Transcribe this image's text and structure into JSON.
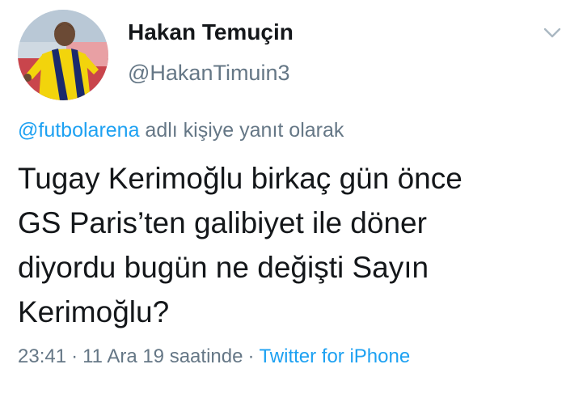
{
  "author": {
    "display_name": "Hakan Temuçin",
    "handle": "@HakanTimuin3"
  },
  "reply": {
    "mention": "@futbolarena",
    "suffix": " adlı kişiye yanıt olarak"
  },
  "tweet": {
    "lines": [
      "Tugay Kerimoğlu birkaç gün önce",
      "GS Paris’ten galibiyet ile döner",
      "diyordu bugün ne değişti Sayın",
      "Kerimoğlu?"
    ]
  },
  "meta": {
    "time": "23:41",
    "date_text": "11 Ara 19 saatinde",
    "separator": "·",
    "source": "Twitter for iPhone"
  },
  "icons": {
    "more": "chevron-down-icon",
    "avatar": "profile-photo"
  },
  "colors": {
    "link": "#1da1f2",
    "secondary_text": "#657786",
    "primary_text": "#14171a"
  }
}
